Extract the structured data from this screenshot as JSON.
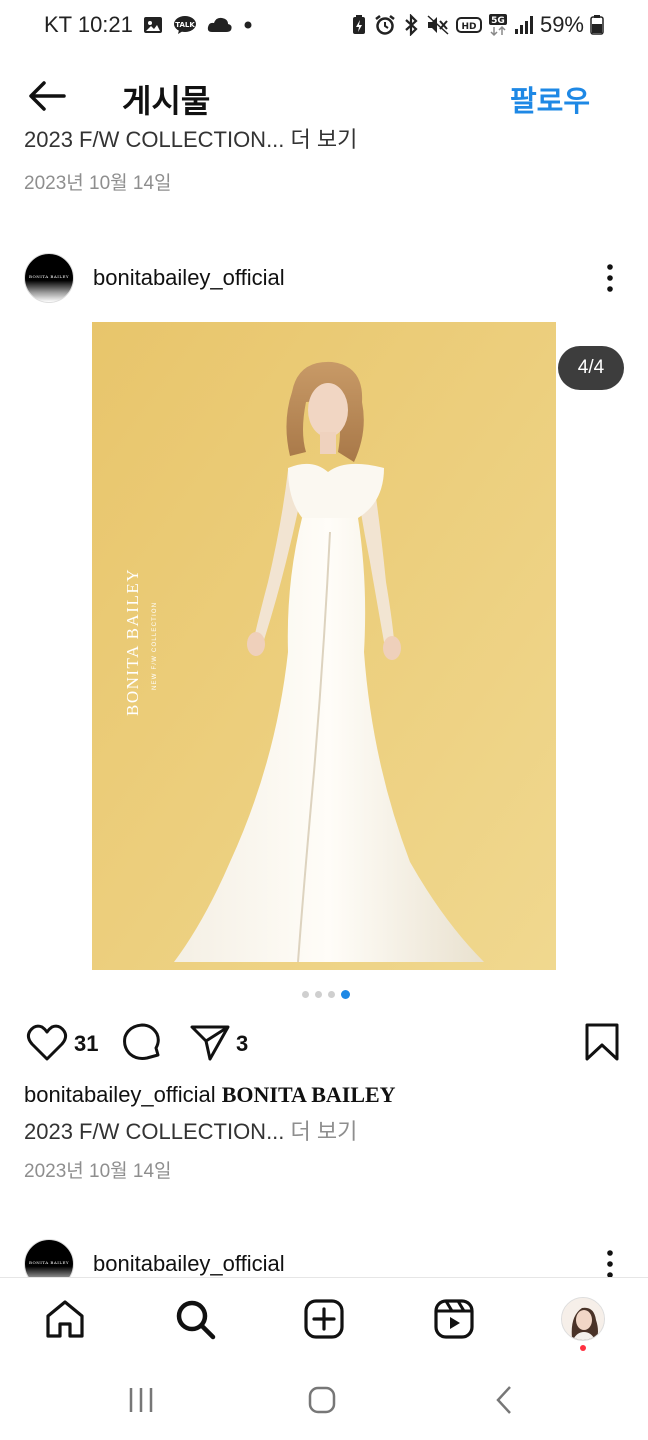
{
  "status_bar": {
    "carrier_time": "KT 10:21",
    "battery": "59%",
    "icons_left": [
      "gallery-icon",
      "kakaotalk-icon",
      "cloud-icon",
      "dot-icon"
    ],
    "icons_right": [
      "battery-saver-icon",
      "alarm-icon",
      "bluetooth-icon",
      "mute-icon",
      "hd-icon",
      "5g-icon",
      "signal-icon",
      "battery-icon"
    ]
  },
  "top_bar": {
    "title": "게시물",
    "follow_label": "팔로우"
  },
  "previous_post": {
    "caption": "2023 F/W COLLECTION... 더 보기",
    "date": "2023년 10월 14일"
  },
  "post": {
    "username": "bonitabailey_official",
    "avatar_text": "BONITA BAILEY",
    "image_counter": "4/4",
    "image_brand_text": "BONITA BAILEY",
    "image_sub_text": "NEW F/W COLLECTION",
    "carousel": {
      "total": 4,
      "active_index": 3
    },
    "likes": "31",
    "shares": "3",
    "caption_user": "bonitabailey_official",
    "caption_brand": "BONITA BAILEY",
    "caption_text": "2023 F/W COLLECTION...",
    "more_label": "더 보기",
    "date": "2023년 10월 14일"
  },
  "next_post": {
    "username": "bonitabailey_official"
  },
  "bottom_nav": {
    "items": [
      "home-icon",
      "search-icon",
      "create-icon",
      "reels-icon",
      "profile-avatar"
    ]
  },
  "colors": {
    "accent": "#1e88e5",
    "image_background": "#ecd07e",
    "notification": "#ff3040"
  }
}
